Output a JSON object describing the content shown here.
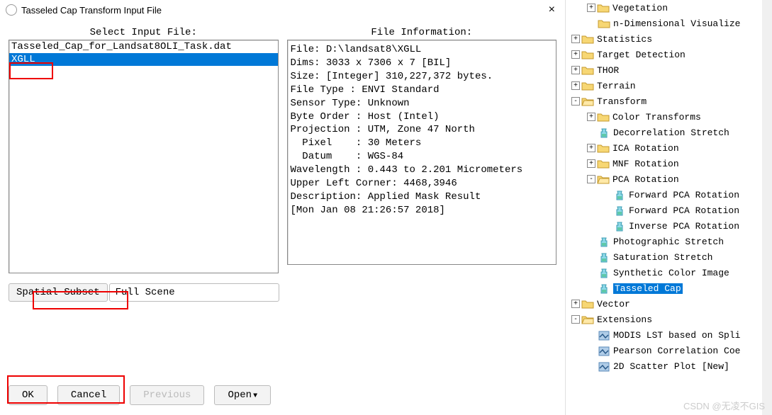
{
  "dialog": {
    "title": "Tasseled Cap Transform Input File",
    "close": "×",
    "select_caption": "Select Input File:",
    "info_caption": "File Information:",
    "files": [
      {
        "name": "Tasseled_Cap_for_Landsat8OLI_Task.dat",
        "selected": false
      },
      {
        "name": "XGLL",
        "selected": true
      }
    ],
    "file_info": "File: D:\\landsat8\\XGLL\nDims: 3033 x 7306 x 7 [BIL]\nSize: [Integer] 310,227,372 bytes.\nFile Type : ENVI Standard\nSensor Type: Unknown\nByte Order : Host (Intel)\nProjection : UTM, Zone 47 North\n  Pixel    : 30 Meters\n  Datum    : WGS-84\nWavelength : 0.443 to 2.201 Micrometers\nUpper Left Corner: 4468,3946\nDescription: Applied Mask Result\n[Mon Jan 08 21:26:57 2018]",
    "spatial_subset_label": "Spatial Subset",
    "spatial_subset_value": "Full Scene",
    "buttons": {
      "ok": "OK",
      "cancel": "Cancel",
      "previous": "Previous",
      "open": "Open"
    }
  },
  "tree": [
    {
      "depth": 1,
      "exp": "+",
      "type": "folder",
      "label": "Vegetation"
    },
    {
      "depth": 1,
      "exp": "",
      "type": "folder",
      "label": "n-Dimensional Visualize"
    },
    {
      "depth": 0,
      "exp": "+",
      "type": "folder",
      "label": "Statistics"
    },
    {
      "depth": 0,
      "exp": "+",
      "type": "folder",
      "label": "Target Detection"
    },
    {
      "depth": 0,
      "exp": "+",
      "type": "folder",
      "label": "THOR"
    },
    {
      "depth": 0,
      "exp": "+",
      "type": "folder",
      "label": "Terrain"
    },
    {
      "depth": 0,
      "exp": "-",
      "type": "folder",
      "label": "Transform"
    },
    {
      "depth": 1,
      "exp": "+",
      "type": "folder",
      "label": "Color Transforms"
    },
    {
      "depth": 1,
      "exp": "",
      "type": "tool",
      "label": "Decorrelation Stretch"
    },
    {
      "depth": 1,
      "exp": "+",
      "type": "folder",
      "label": "ICA Rotation"
    },
    {
      "depth": 1,
      "exp": "+",
      "type": "folder",
      "label": "MNF Rotation"
    },
    {
      "depth": 1,
      "exp": "-",
      "type": "folder",
      "label": "PCA Rotation"
    },
    {
      "depth": 2,
      "exp": "",
      "type": "tool",
      "label": "Forward PCA Rotation"
    },
    {
      "depth": 2,
      "exp": "",
      "type": "tool",
      "label": "Forward PCA Rotation"
    },
    {
      "depth": 2,
      "exp": "",
      "type": "tool",
      "label": "Inverse PCA Rotation"
    },
    {
      "depth": 1,
      "exp": "",
      "type": "tool",
      "label": "Photographic Stretch"
    },
    {
      "depth": 1,
      "exp": "",
      "type": "tool",
      "label": "Saturation Stretch"
    },
    {
      "depth": 1,
      "exp": "",
      "type": "tool",
      "label": "Synthetic Color Image"
    },
    {
      "depth": 1,
      "exp": "",
      "type": "tool",
      "label": "Tasseled Cap",
      "selected": true
    },
    {
      "depth": 0,
      "exp": "+",
      "type": "folder",
      "label": "Vector"
    },
    {
      "depth": 0,
      "exp": "-",
      "type": "folder",
      "label": "Extensions"
    },
    {
      "depth": 1,
      "exp": "",
      "type": "ext",
      "label": "MODIS LST based on Spli"
    },
    {
      "depth": 1,
      "exp": "",
      "type": "ext",
      "label": "Pearson Correlation Coe"
    },
    {
      "depth": 1,
      "exp": "",
      "type": "ext",
      "label": "2D Scatter Plot [New]"
    }
  ],
  "watermark": "CSDN @无凌不GIS"
}
